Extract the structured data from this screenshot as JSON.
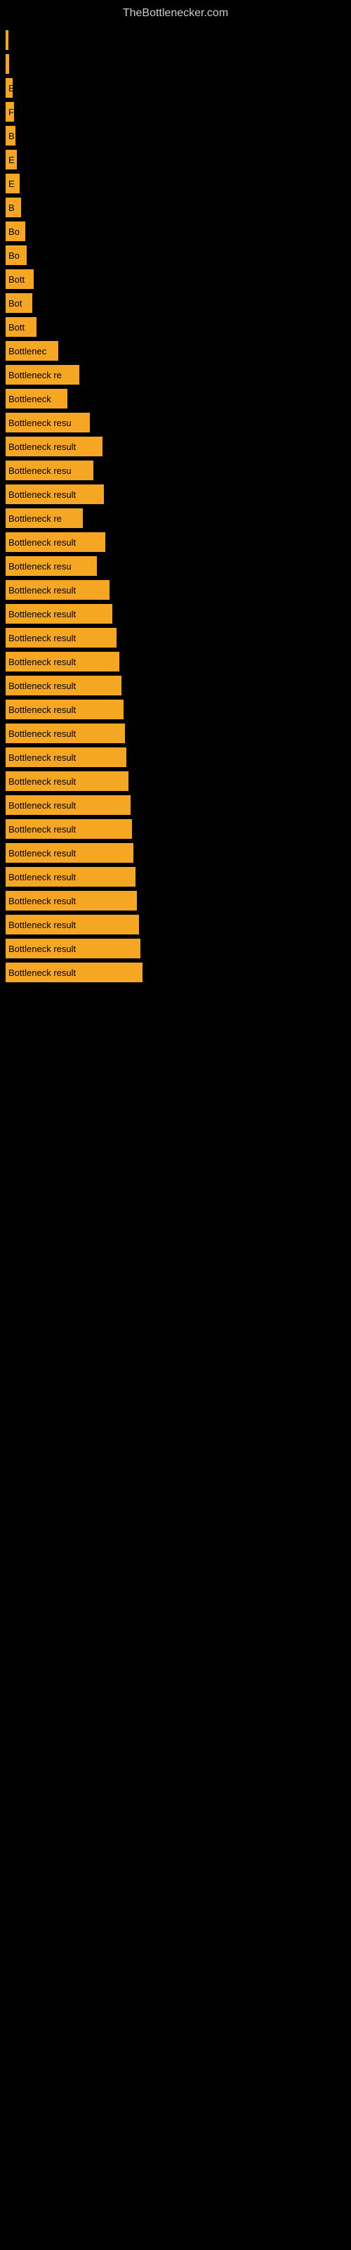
{
  "site": {
    "title": "TheBottlenecker.com"
  },
  "bars": [
    {
      "label": "|",
      "width": 4
    },
    {
      "label": "|",
      "width": 5
    },
    {
      "label": "E",
      "width": 10
    },
    {
      "label": "F",
      "width": 12
    },
    {
      "label": "B",
      "width": 14
    },
    {
      "label": "E",
      "width": 16
    },
    {
      "label": "E",
      "width": 20
    },
    {
      "label": "B",
      "width": 22
    },
    {
      "label": "Bo",
      "width": 28
    },
    {
      "label": "Bo",
      "width": 30
    },
    {
      "label": "Bott",
      "width": 40
    },
    {
      "label": "Bot",
      "width": 38
    },
    {
      "label": "Bott",
      "width": 44
    },
    {
      "label": "Bottlenec",
      "width": 75
    },
    {
      "label": "Bottleneck re",
      "width": 105
    },
    {
      "label": "Bottleneck",
      "width": 88
    },
    {
      "label": "Bottleneck resu",
      "width": 120
    },
    {
      "label": "Bottleneck result",
      "width": 138
    },
    {
      "label": "Bottleneck resu",
      "width": 125
    },
    {
      "label": "Bottleneck result",
      "width": 140
    },
    {
      "label": "Bottleneck re",
      "width": 110
    },
    {
      "label": "Bottleneck result",
      "width": 142
    },
    {
      "label": "Bottleneck resu",
      "width": 130
    },
    {
      "label": "Bottleneck result",
      "width": 148
    },
    {
      "label": "Bottleneck result",
      "width": 152
    },
    {
      "label": "Bottleneck result",
      "width": 158
    },
    {
      "label": "Bottleneck result",
      "width": 162
    },
    {
      "label": "Bottleneck result",
      "width": 165
    },
    {
      "label": "Bottleneck result",
      "width": 168
    },
    {
      "label": "Bottleneck result",
      "width": 170
    },
    {
      "label": "Bottleneck result",
      "width": 172
    },
    {
      "label": "Bottleneck result",
      "width": 175
    },
    {
      "label": "Bottleneck result",
      "width": 178
    },
    {
      "label": "Bottleneck result",
      "width": 180
    },
    {
      "label": "Bottleneck result",
      "width": 182
    },
    {
      "label": "Bottleneck result",
      "width": 185
    },
    {
      "label": "Bottleneck result",
      "width": 187
    },
    {
      "label": "Bottleneck result",
      "width": 190
    },
    {
      "label": "Bottleneck result",
      "width": 192
    },
    {
      "label": "Bottleneck result",
      "width": 195
    }
  ]
}
